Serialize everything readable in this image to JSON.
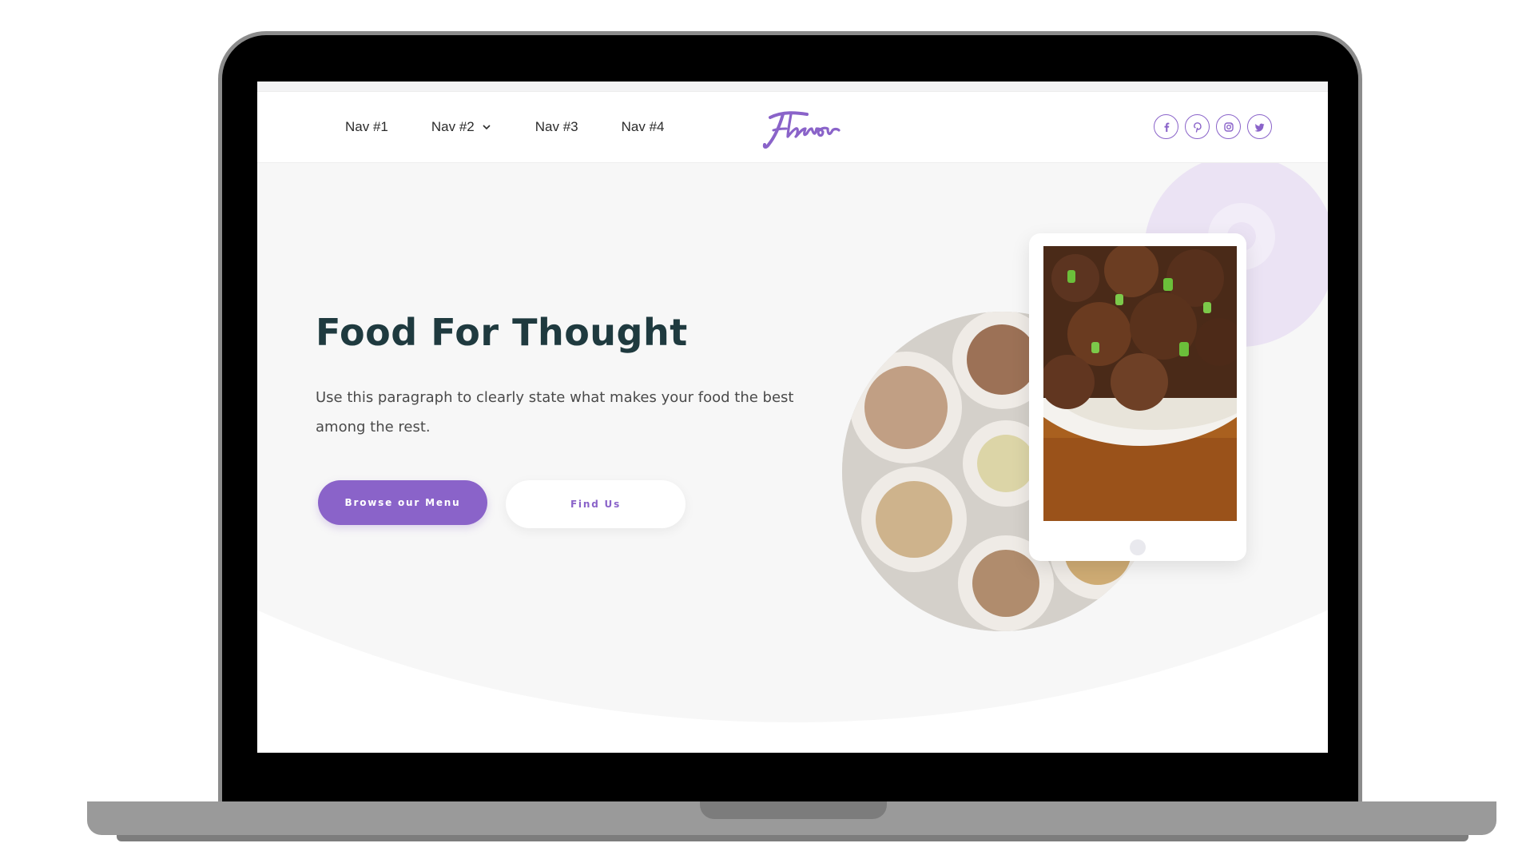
{
  "colors": {
    "accent": "#8a63c9",
    "heading": "#1f3a3f",
    "hero_bg": "#f7f7f7"
  },
  "header": {
    "nav": [
      {
        "label": "Nav #1"
      },
      {
        "label": "Nav #2",
        "has_dropdown": true
      },
      {
        "label": "Nav #3"
      },
      {
        "label": "Nav #4"
      }
    ],
    "logo_text": "Flavor",
    "socials": [
      {
        "icon": "facebook-icon"
      },
      {
        "icon": "pinterest-icon"
      },
      {
        "icon": "instagram-icon"
      },
      {
        "icon": "twitter-icon"
      }
    ]
  },
  "hero": {
    "title": "Food For Thought",
    "paragraph": "Use this paragraph to clearly state what makes your food the best among the rest.",
    "primary_button": "Browse our Menu",
    "secondary_button": "Find Us"
  }
}
